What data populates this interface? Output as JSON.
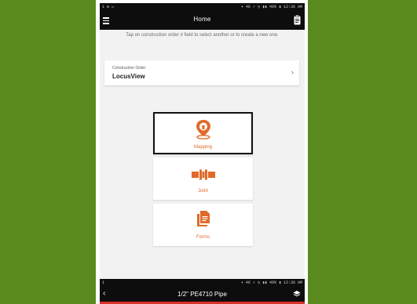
{
  "status_bar": {
    "left": "1 ⊡ ▭",
    "right": "▾ 46 ⚡ ◷ ▮▮ 49% ▮ 12:36 AM"
  },
  "app_bar": {
    "title": "Home",
    "menu_icon": "menu-icon",
    "right_icon": "clipboard-icon"
  },
  "instruction": "Tap on construction order # field to select another or to create a new one.",
  "construction_order": {
    "label": "Construction Order",
    "value": "LocusView",
    "chevron": "›"
  },
  "tiles": [
    {
      "label": "Mapping",
      "icon": "map-pin-icon",
      "selected": true
    },
    {
      "label": "Joint",
      "icon": "pipe-joint-icon",
      "selected": false
    },
    {
      "label": "Forms",
      "icon": "forms-icon",
      "selected": false
    }
  ],
  "bottom_status": {
    "left": "1",
    "right": "▾ 46 ⚡ ◷ ▮▮ 49% ▮ 12:36 AM"
  },
  "bottom_bar": {
    "back": "‹",
    "title": "1/2\" PE4710 Pipe",
    "right_icon": "layers-icon"
  },
  "colors": {
    "accent": "#e06a2a",
    "background": "#5a8a1e",
    "appbar": "#0d0d0d",
    "strip": "#d9302a"
  }
}
